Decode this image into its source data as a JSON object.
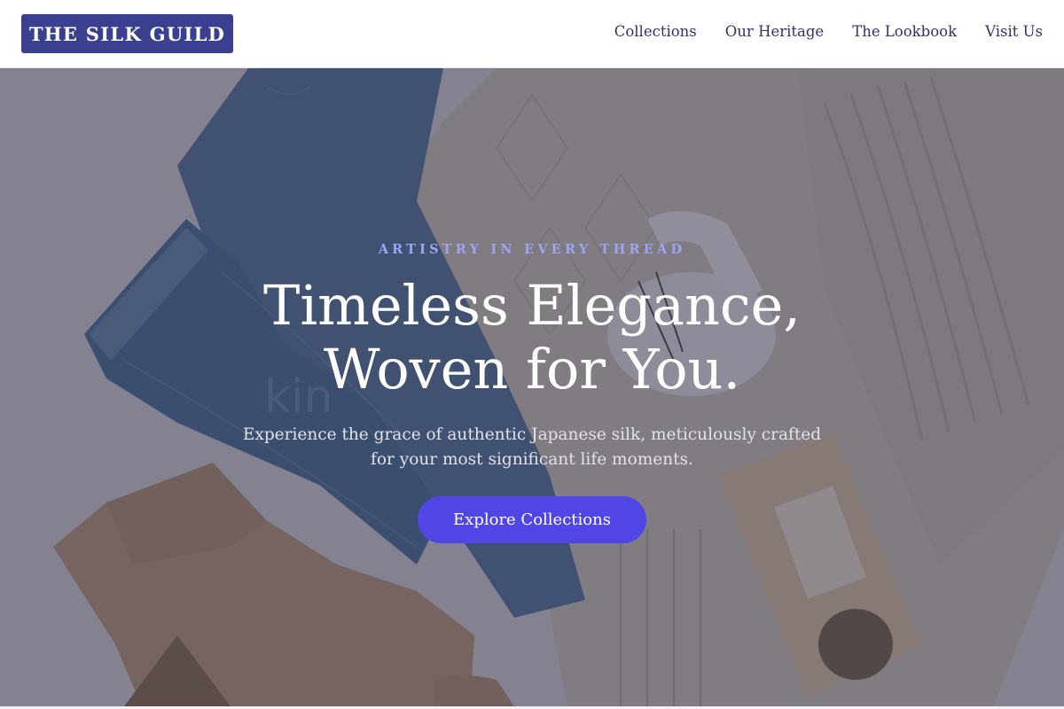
{
  "header": {
    "logo": "THE SILK GUILD",
    "nav": [
      {
        "label": "Collections"
      },
      {
        "label": "Our Heritage"
      },
      {
        "label": "The Lookbook"
      },
      {
        "label": "Visit Us"
      }
    ]
  },
  "hero": {
    "eyebrow": "ARTISTRY IN EVERY THREAD",
    "headline_line1": "Timeless Elegance,",
    "headline_line2": "Woven for You.",
    "subtext": "Experience the grace of authentic Japanese silk, meticulously crafted for your most significant life moments.",
    "cta_label": "Explore Collections",
    "background_image": "flat-lay-photo-jeans-knit-sweater-boot-mug-tea-bag"
  },
  "colors": {
    "logo_bg": "#3b3f8f",
    "nav_text": "#2f3470",
    "eyebrow": "#9ea4f3",
    "cta_bg": "#4f46e5",
    "overlay": "#1c1a34"
  }
}
